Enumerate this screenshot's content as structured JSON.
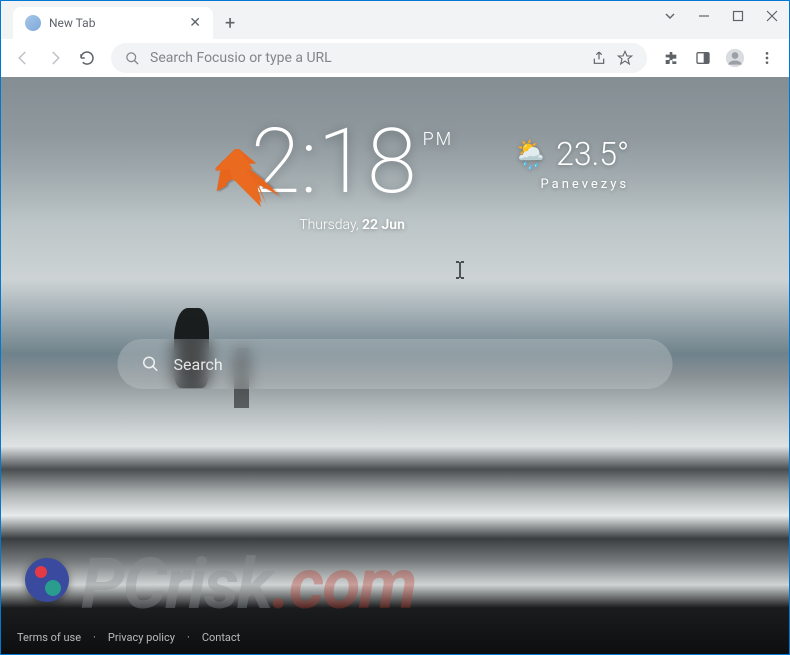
{
  "window": {
    "tab_title": "New Tab"
  },
  "omnibox": {
    "placeholder": "Search Focusio or type a URL"
  },
  "clock": {
    "time": "2:18",
    "ampm": "PM",
    "day": "Thursday,",
    "date": "22 Jun"
  },
  "weather": {
    "temp": "23.5°",
    "city": "Panevezys"
  },
  "search_widget": {
    "placeholder": "Search"
  },
  "footer": {
    "terms": "Terms of use",
    "privacy": "Privacy policy",
    "contact": "Contact"
  },
  "watermark": {
    "p": "P",
    "c": "C",
    "risk": "risk",
    "dotcom": ".com"
  }
}
